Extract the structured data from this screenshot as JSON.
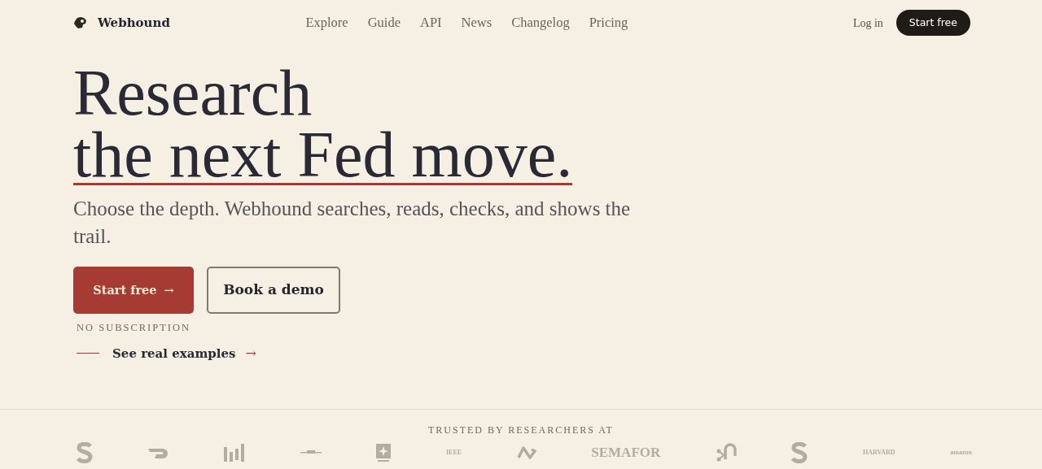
{
  "header": {
    "brand": "Webhound",
    "nav": [
      {
        "label": "Explore"
      },
      {
        "label": "Guide"
      },
      {
        "label": "API"
      },
      {
        "label": "News"
      },
      {
        "label": "Changelog"
      },
      {
        "label": "Pricing"
      }
    ],
    "login": "Log in",
    "cta": "Start free"
  },
  "hero": {
    "title_line_1": "Research",
    "title_line_2": "the next Fed move.",
    "subtitle": "Choose the depth. Webhound searches, reads, checks, and shows the trail.",
    "primary_button": "Start free",
    "primary_arrow": "→",
    "secondary_button": "Book a demo",
    "note": "NO SUBSCRIPTION",
    "examples_link": "See real examples",
    "examples_arrow": "→"
  },
  "trusted": {
    "heading": "TRUSTED BY RESEARCHERS AT",
    "logos": [
      {
        "kind": "s"
      },
      {
        "kind": "swoosh"
      },
      {
        "kind": "bars"
      },
      {
        "kind": "line"
      },
      {
        "kind": "star"
      },
      {
        "kind": "small_text",
        "label": "IEEE"
      },
      {
        "kind": "loop"
      },
      {
        "kind": "text",
        "label": "SEMAFOR"
      },
      {
        "kind": "hook"
      },
      {
        "kind": "s"
      },
      {
        "kind": "small_text",
        "label": "HARVARD"
      },
      {
        "kind": "small_text",
        "label": "amazon"
      }
    ]
  }
}
